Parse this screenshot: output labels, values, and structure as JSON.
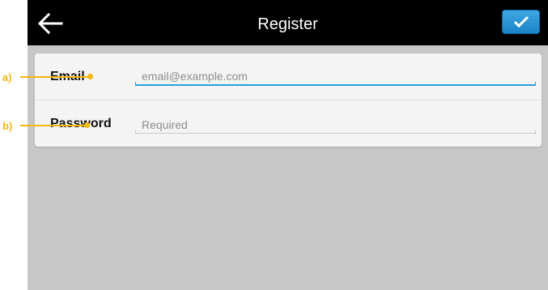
{
  "actionbar": {
    "title": "Register",
    "back_icon": "back-arrow-icon",
    "confirm_icon": "checkmark-icon"
  },
  "form": {
    "email": {
      "label": "Email",
      "placeholder": "email@example.com",
      "value": ""
    },
    "password": {
      "label": "Password",
      "placeholder": "Required",
      "value": ""
    }
  },
  "annotations": {
    "a": "a)",
    "b": "b)"
  },
  "colors": {
    "actionbar_bg": "#000000",
    "confirm_accent": "#1a83c6",
    "focus_underline": "#2a9fd6",
    "annotation": "#f5b70a",
    "content_bg": "#c7c7c7"
  }
}
